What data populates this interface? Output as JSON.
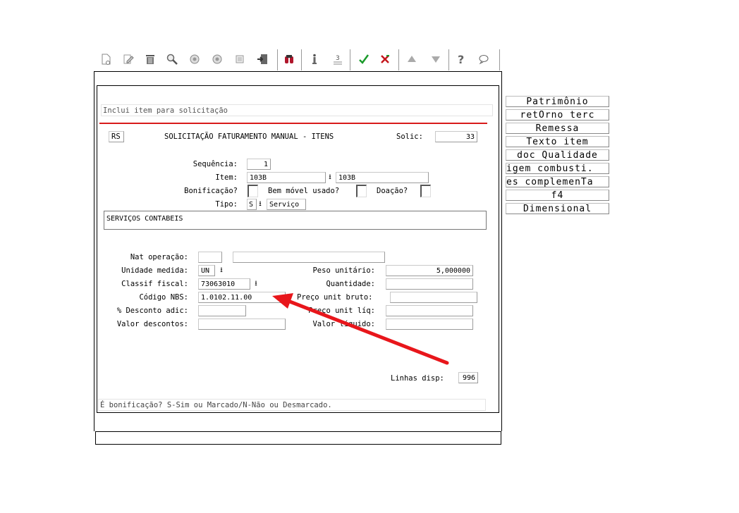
{
  "toolbar": {
    "icons": [
      "new-icon",
      "edit-icon",
      "trash-icon",
      "search-icon",
      "prev-record-icon",
      "next-record-icon",
      "document-icon",
      "export-icon",
      "binoculars-icon",
      "info-icon",
      "list-icon",
      "confirm-icon",
      "cancel-icon",
      "up-icon",
      "down-icon",
      "help-icon",
      "comment-icon"
    ]
  },
  "header": {
    "hint": "Inclui item para solicitação",
    "rs": "RS",
    "title": "SOLICITAÇÃO FATURAMENTO MANUAL - ITENS",
    "solic_label": "Solic:",
    "solic_value": "33"
  },
  "form": {
    "sequencia_label": "Sequência:",
    "sequencia_value": "1",
    "item_label": "Item:",
    "item_code": "103B",
    "item_desc": "103B",
    "bonificacao_label": "Bonificação?",
    "bem_movel_label": "Bem móvel usado?",
    "doacao_label": "Doação?",
    "tipo_label": "Tipo:",
    "tipo_value": "S",
    "tipo_desc": "Serviço",
    "descricao": "SERVIÇOS CONTABEIS",
    "nat_operacao_label": "Nat operação:",
    "nat_operacao_value": "",
    "nat_operacao_desc": "",
    "unidade_label": "Unidade medida:",
    "unidade_value": "UN",
    "peso_label": "Peso unitário:",
    "peso_value": "5,000000",
    "classif_label": "Classif fiscal:",
    "classif_value": "73063010",
    "quantidade_label": "Quantidade:",
    "quantidade_value": "",
    "nbs_label": "Código NBS:",
    "nbs_value": "1.0102.11.00",
    "preco_bruto_label": "Preço unit bruto:",
    "preco_bruto_value": "",
    "desconto_label": "% Desconto adic:",
    "desconto_value": "",
    "preco_liq_label": "Preço unit líq:",
    "preco_liq_value": "",
    "valor_desc_label": "Valor descontos:",
    "valor_desc_value": "",
    "valor_liq_label": "Valor líquido:",
    "valor_liq_value": "",
    "linhas_label": "Linhas disp:",
    "linhas_value": "996"
  },
  "status": "É bonificação? S-Sim ou Marcado/N-Não ou Desmarcado.",
  "side_buttons": [
    "Patrimônio",
    "retOrno terc",
    "Remessa",
    "Texto item",
    "doc Qualidade",
    "igem combusti.",
    "es complemenTa",
    "f4",
    "Dimensional"
  ],
  "annotation": {
    "arrow_color": "#e8161b"
  }
}
